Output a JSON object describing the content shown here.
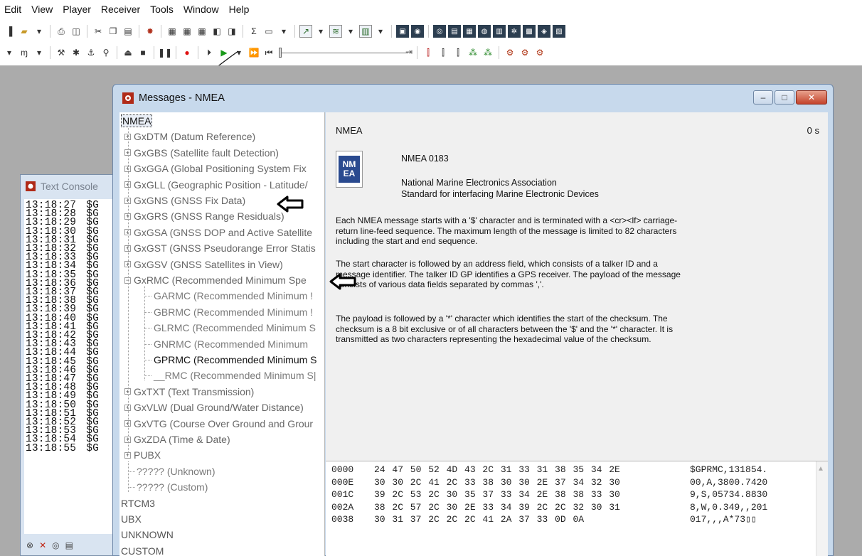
{
  "menubar": [
    "Edit",
    "View",
    "Player",
    "Receiver",
    "Tools",
    "Window",
    "Help"
  ],
  "toolbar1_icons": [
    "new-icon",
    "open-icon",
    "print-icon",
    "preview-icon",
    "cut-icon",
    "copy-icon",
    "paste-icon",
    "configure-icon",
    "docs-icon",
    "docs2-icon",
    "docs3-icon",
    "view-split-icon",
    "view-panel-icon",
    "sum-icon",
    "panel-icon",
    "chart-icon",
    "chart2-icon",
    "chart3-icon",
    "dark-view-icon",
    "dark-view2-icon",
    "dark-view3-icon",
    "dark-view4-icon",
    "dark-view5-icon",
    "dark-view6-icon",
    "dark-view7-icon",
    "dark-view8-icon",
    "dark-view9-icon",
    "dark-view10-icon"
  ],
  "toolbar2_icons": [
    "wave-icon",
    "tool-icon",
    "antenna-icon",
    "satellite-icon",
    "dock-icon",
    "eject-icon",
    "stop-icon",
    "pause-icon",
    "record-icon",
    "play-icon",
    "play-dropdown-icon",
    "fast-forward-icon",
    "skip-back-icon",
    "skip-end-icon",
    "hot-icon",
    "warm-icon",
    "cold-icon",
    "settings-icon",
    "settings2-icon",
    "gear-icon",
    "gear2-icon",
    "gear3-icon"
  ],
  "console": {
    "title": "Text Console",
    "prefix": "$G",
    "times": [
      "13:18:27",
      "13:18:28",
      "13:18:29",
      "13:18:30",
      "13:18:31",
      "13:18:32",
      "13:18:33",
      "13:18:34",
      "13:18:35",
      "13:18:36",
      "13:18:37",
      "13:18:38",
      "13:18:39",
      "13:18:40",
      "13:18:41",
      "13:18:42",
      "13:18:43",
      "13:18:44",
      "13:18:45",
      "13:18:46",
      "13:18:47",
      "13:18:48",
      "13:18:49",
      "13:18:50",
      "13:18:51",
      "13:18:52",
      "13:18:53",
      "13:18:54",
      "13:18:55"
    ]
  },
  "window": {
    "title": "Messages - NMEA",
    "tree": {
      "root": "NMEA",
      "items": [
        "GxDTM (Datum Reference)",
        "GxGBS (Satellite fault Detection)",
        "GxGGA (Global Positioning System Fix",
        "GxGLL (Geographic Position - Latitude/",
        "GxGNS (GNSS Fix Data)",
        "GxGRS (GNSS Range Residuals)",
        "GxGSA (GNSS DOP and Active Satellite",
        "GxGST (GNSS Pseudorange Error Statis",
        "GxGSV (GNSS Satellites in View)",
        "GxRMC (Recommended Minimum Spe"
      ],
      "rmc_children": [
        "GARMC (Recommended Minimum !",
        "GBRMC (Recommended Minimum !",
        "GLRMC (Recommended Minimum S",
        "GNRMC (Recommended Minimum",
        "GPRMC (Recommended Minimum S",
        "__RMC (Recommended Minimum S|"
      ],
      "items_after": [
        "GxTXT (Text Transmission)",
        "GxVLW (Dual Ground/Water Distance)",
        "GxVTG (Course Over Ground and Grour",
        "GxZDA (Time & Date)",
        "PUBX"
      ],
      "unknown_children": [
        "????? (Unknown)",
        "????? (Custom)"
      ],
      "other_roots": [
        "RTCM3",
        "UBX",
        "UNKNOWN",
        "CUSTOM"
      ]
    },
    "detail": {
      "name": "NMEA",
      "time": "0 s",
      "logo_text": "NM EA",
      "standard": "NMEA 0183",
      "org_line1": "National Marine Electronics Association",
      "org_line2": "Standard for interfacing Marine Electronic Devices",
      "para1": "Each NMEA message starts with a '$' character and is terminated with a <cr><lf> carriage-return line-feed sequence. The maximum length of the message is limited to 82 characters including the start and end sequence.",
      "para2": "The start character is followed by an address field, which consists of a talker ID and a message identifier. The talker ID GP identifies a GPS receiver. The payload of the message consists of various data fields separated by commas ','.",
      "para3": "The payload is followed by a '*' character which identifies the start of the checksum. The checksum is a 8 bit exclusive or of all characters between the '$' and the '*' character. It is transmitted as two characters representing the hexadecimal value of the checksum."
    },
    "hex": [
      {
        "offset": "0000",
        "bytes": "24 47 50 52 4D 43 2C 31 33 31 38 35 34 2E",
        "ascii": "$GPRMC,131854."
      },
      {
        "offset": "000E",
        "bytes": "30 30 2C 41 2C 33 38 30 30 2E 37 34 32 30",
        "ascii": "00,A,3800.7420"
      },
      {
        "offset": "001C",
        "bytes": "39 2C 53 2C 30 35 37 33 34 2E 38 38 33 30",
        "ascii": "9,S,05734.8830"
      },
      {
        "offset": "002A",
        "bytes": "38 2C 57 2C 30 2E 33 34 39 2C 2C 32 30 31",
        "ascii": "8,W,0.349,,201"
      },
      {
        "offset": "0038",
        "bytes": "30 31 37 2C 2C 2C 41 2A 37 33 0D 0A",
        "ascii": "017,,,A*73▯▯"
      }
    ]
  }
}
